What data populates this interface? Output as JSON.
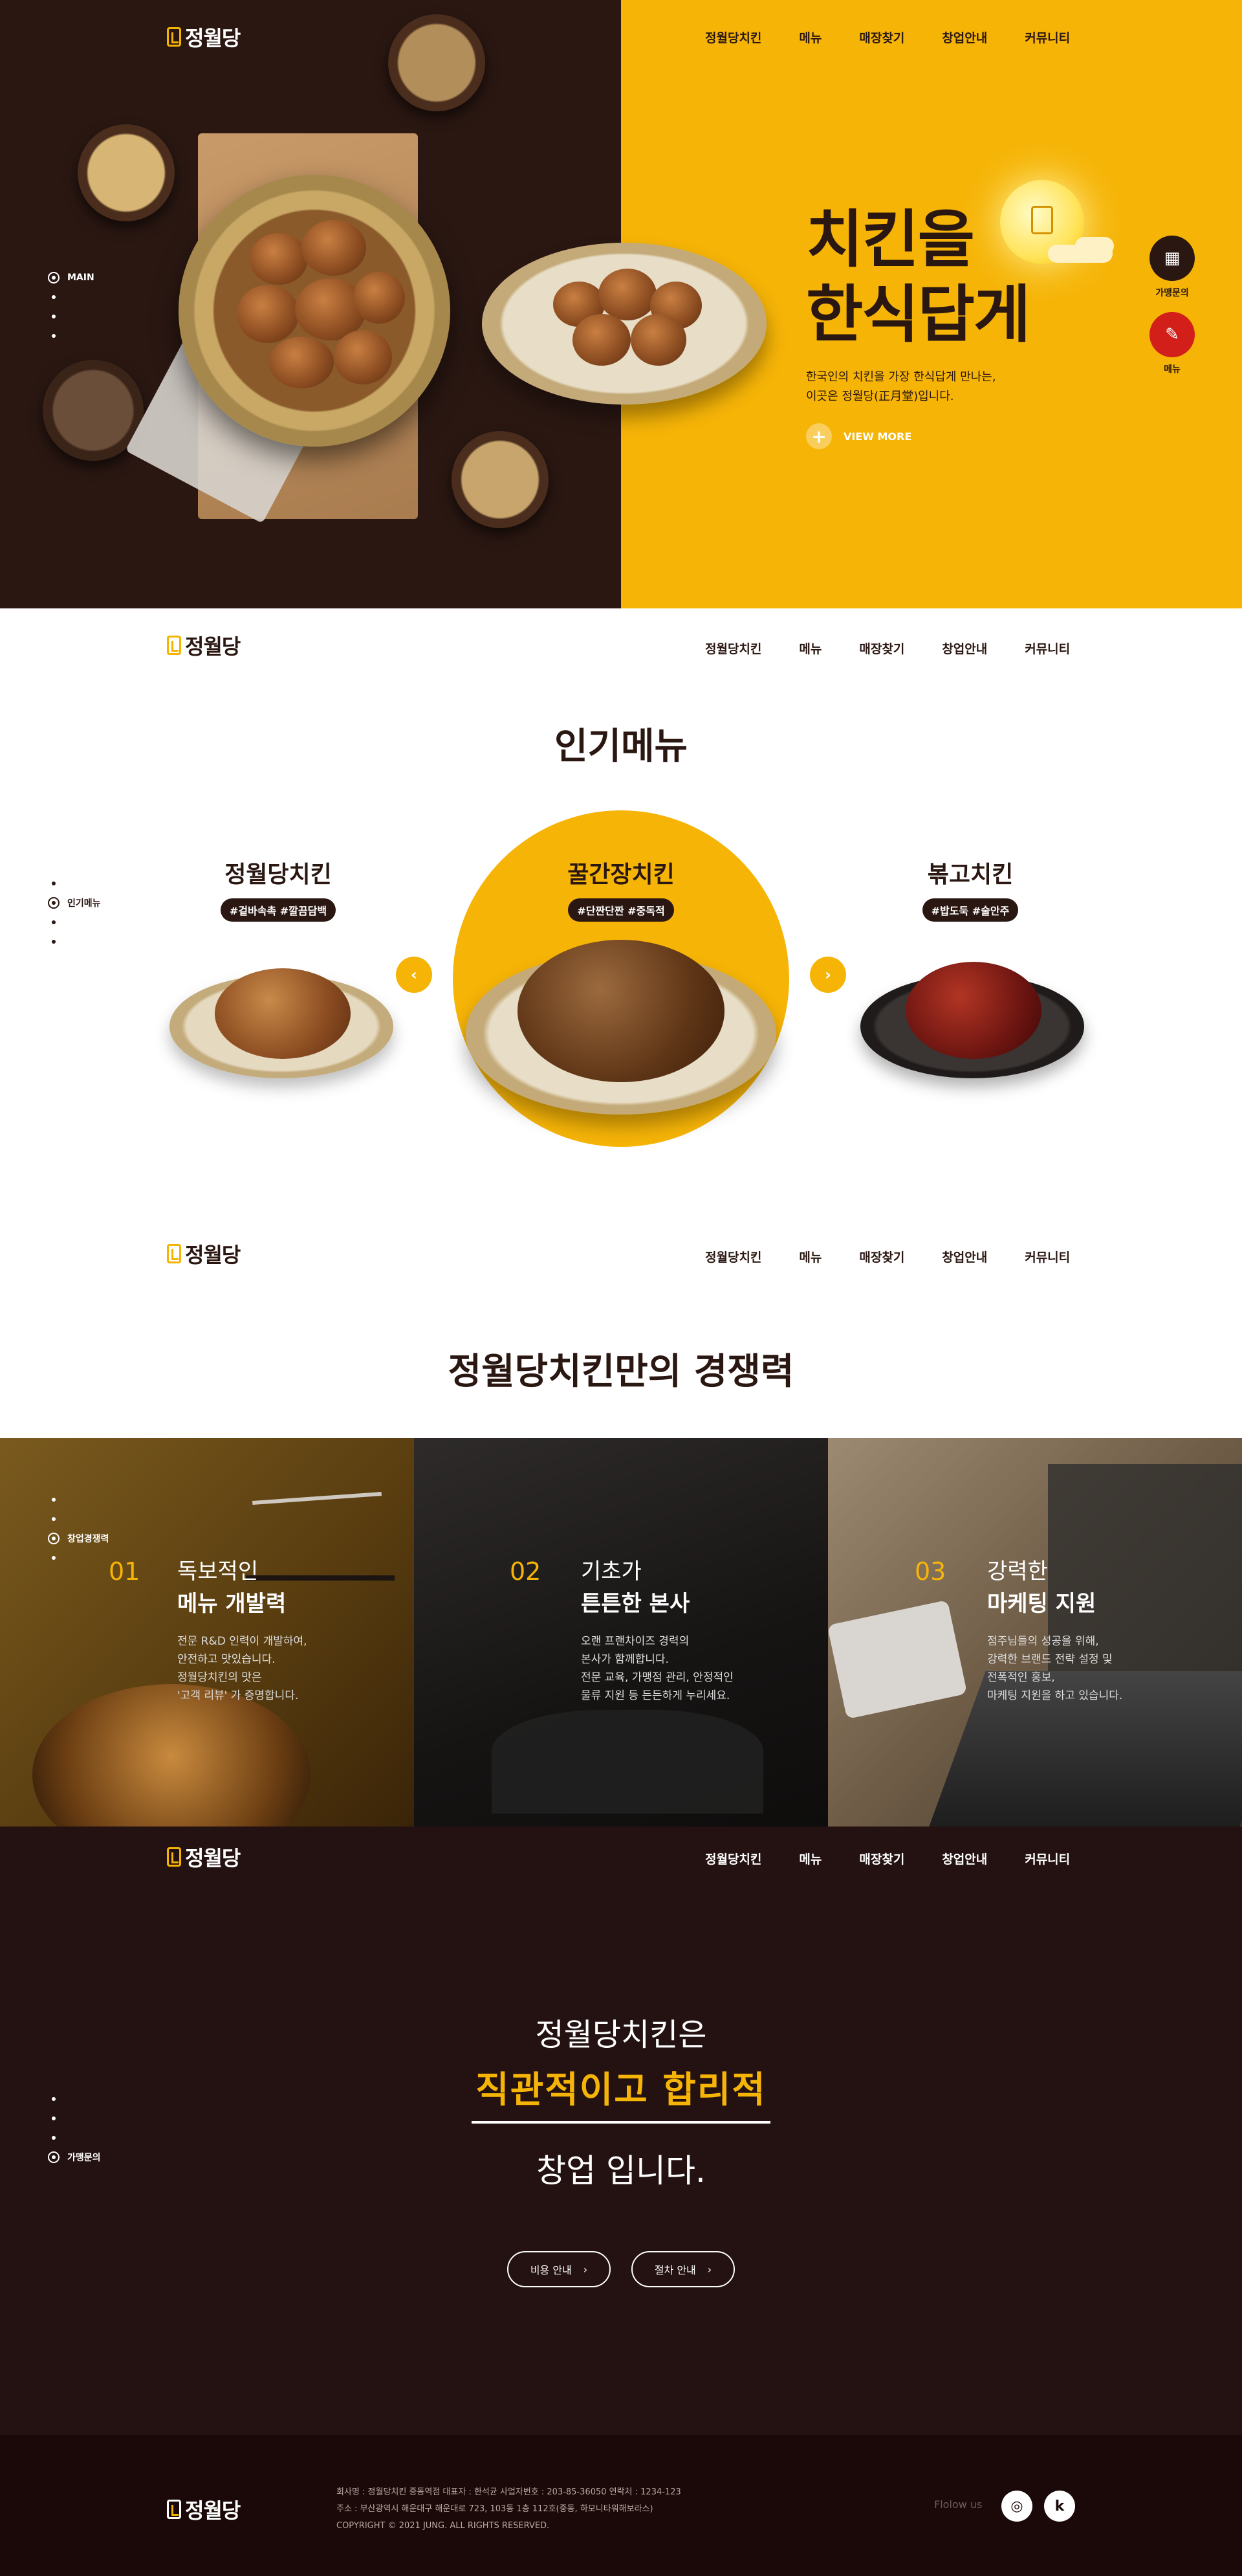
{
  "brand": {
    "logo_text": "정월당",
    "accent": "#f6b407",
    "dark": "#2a1712"
  },
  "nav": {
    "items": [
      "정월당치킨",
      "메뉴",
      "매장찾기",
      "창업안내",
      "커뮤니티"
    ]
  },
  "hero": {
    "title_line1": "치킨을",
    "title_line2": "한식답게",
    "desc_line1": "한국인의 치킨을 가장 한식답게 만나는,",
    "desc_line2": "이곳은 정월당(正月堂)입니다.",
    "view_more": "VIEW MORE",
    "moon_label": "정월당",
    "pager_active": "MAIN",
    "quick_franchise": "가맹문의",
    "quick_menu": "메뉴"
  },
  "popular": {
    "title": "인기메뉴",
    "pager_active": "인기메뉴",
    "items": [
      {
        "name": "정월당치킨",
        "tag": "#겉바속촉 #깔끔담백"
      },
      {
        "name": "꿀간장치킨",
        "tag": "#단짠단짠 #중독적"
      },
      {
        "name": "볶고치킨",
        "tag": "#밥도둑 #술안주"
      }
    ]
  },
  "features": {
    "title": "정월당치킨만의 경쟁력",
    "pager_active": "창업경쟁력",
    "tiles": [
      {
        "num": "01",
        "t1": "독보적인",
        "t2": "메뉴 개발력",
        "d1": "전문 R&D 인력이 개발하여,",
        "d2": "안전하고 맛있습니다.",
        "d3": "정월당치킨의 맛은",
        "d4": "'고객 리뷰' 가 증명합니다."
      },
      {
        "num": "02",
        "t1": "기초가",
        "t2": "튼튼한 본사",
        "d1": "오랜 프랜차이즈 경력의",
        "d2": "본사가 함께합니다.",
        "d3": "전문 교육, 가맹점 관리, 안정적인",
        "d4": "물류 지원 등 든든하게 누리세요."
      },
      {
        "num": "03",
        "t1": "강력한",
        "t2": "마케팅 지원",
        "d1": "점주님들의 성공을 위해,",
        "d2": "강력한 브랜드 전략 설정 및",
        "d3": "전폭적인 홍보,",
        "d4": "마케팅 지원을 하고 있습니다."
      }
    ]
  },
  "startup": {
    "line1": "정월당치킨은",
    "line2": "직관적이고 합리적",
    "line3": "창업 입니다.",
    "btn_cost": "비용 안내",
    "btn_process": "절차 안내",
    "pager_active": "가맹문의"
  },
  "footer": {
    "line1": "회사명 : 정월당치킨 중동역점     대표자 : 한석균     사업자번호 : 203-85-36050     연락처 : 1234-123",
    "line2": "주소 : 부산광역시 해운대구 해운대로 723, 103동 1층 112호(중동, 하모니타워해보라스)",
    "line3": "COPYRIGHT © 2021 JUNG. ALL RIGHTS RESERVED.",
    "follow": "Flolow us",
    "sns1": "instagram-icon",
    "sns2": "kakao-icon"
  }
}
